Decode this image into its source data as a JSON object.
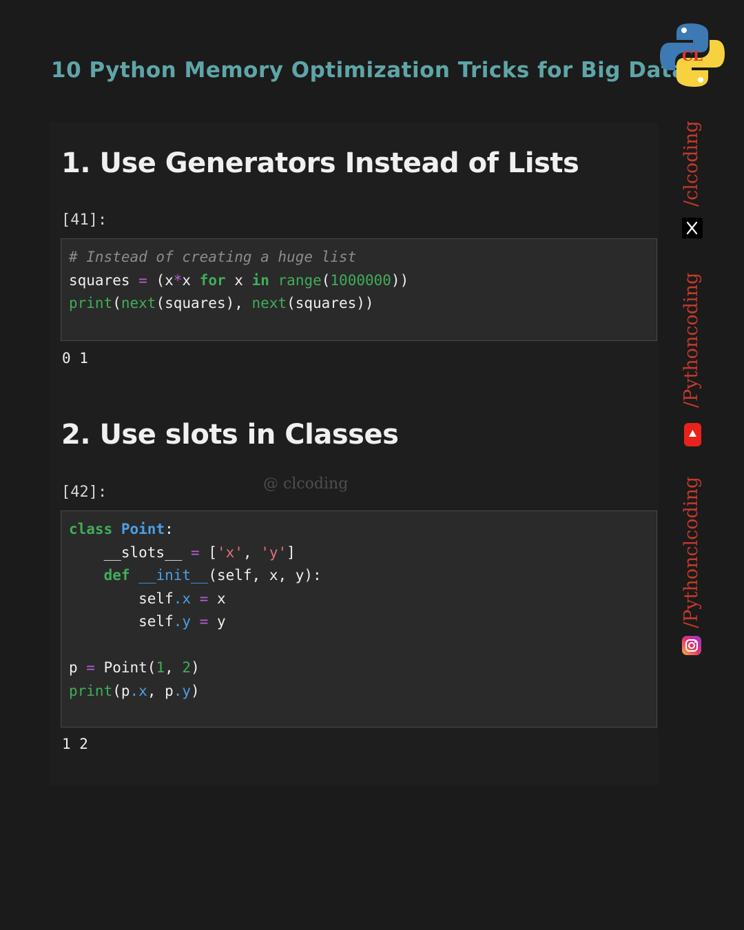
{
  "header": {
    "title": "10 Python Memory Optimization Tricks for Big Data",
    "logo_text": "CL"
  },
  "section1": {
    "heading": "1. Use Generators Instead of Lists",
    "prompt": "[41]:",
    "output": "0 1"
  },
  "section2": {
    "heading": "2. Use slots in Classes",
    "prompt": "[42]:",
    "output": "1 2"
  },
  "watermark": "@ clcoding",
  "sidebar": {
    "handles": [
      {
        "text": "/clcoding",
        "icon": "x-icon"
      },
      {
        "text": "/Pythoncoding",
        "icon": "youtube-icon"
      },
      {
        "text": "/Pythonclcoding",
        "icon": "instagram-icon"
      }
    ]
  },
  "colors": {
    "title": "#5fa5a8",
    "keyword": "#3fae5a",
    "operator": "#b45fd6",
    "name": "#4b9fe6",
    "string": "#e0707a",
    "comment": "#8c8c8c",
    "handle": "#c4392b"
  }
}
